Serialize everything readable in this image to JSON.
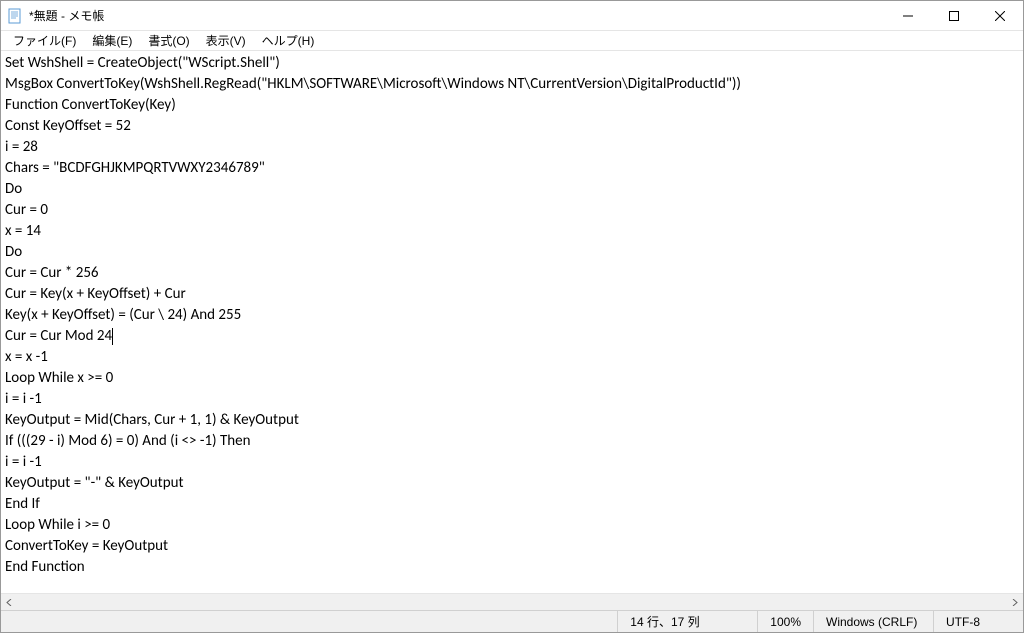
{
  "titlebar": {
    "title": "*無題 - メモ帳"
  },
  "menubar": {
    "file": "ファイル(F)",
    "edit": "編集(E)",
    "format": "書式(O)",
    "view": "表示(V)",
    "help": "ヘルプ(H)"
  },
  "content": {
    "lines": [
      "Set WshShell = CreateObject(\"WScript.Shell\")",
      "MsgBox ConvertToKey(WshShell.RegRead(\"HKLM\\SOFTWARE\\Microsoft\\Windows NT\\CurrentVersion\\DigitalProductId\"))",
      "Function ConvertToKey(Key)",
      "Const KeyOffset = 52",
      "i = 28",
      "Chars = \"BCDFGHJKMPQRTVWXY2346789\"",
      "Do",
      "Cur = 0",
      "x = 14",
      "Do",
      "Cur = Cur * 256",
      "Cur = Key(x + KeyOffset) + Cur",
      "Key(x + KeyOffset) = (Cur \\ 24) And 255",
      "Cur = Cur Mod 24",
      "x = x -1",
      "Loop While x >= 0",
      "i = i -1",
      "KeyOutput = Mid(Chars, Cur + 1, 1) & KeyOutput",
      "If (((29 - i) Mod 6) = 0) And (i <> -1) Then",
      "i = i -1",
      "KeyOutput = \"-\" & KeyOutput",
      "End If",
      "Loop While i >= 0",
      "ConvertToKey = KeyOutput",
      "End Function"
    ],
    "cursor_line": 13,
    "cursor_col": 16
  },
  "statusbar": {
    "position": "14 行、17 列",
    "zoom": "100%",
    "lineending": "Windows (CRLF)",
    "encoding": "UTF-8"
  }
}
